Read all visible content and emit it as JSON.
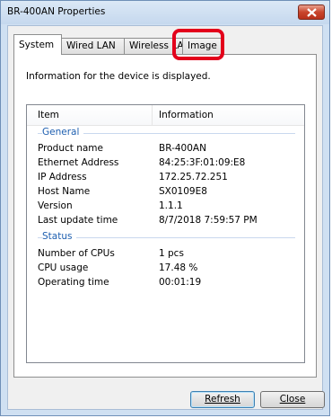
{
  "window": {
    "title": "BR-400AN Properties"
  },
  "tabs": [
    {
      "label": "System"
    },
    {
      "label": "Wired LAN"
    },
    {
      "label": "Wireless LAN"
    },
    {
      "label": "Image"
    }
  ],
  "panel": {
    "description": "Information for the device is displayed."
  },
  "list": {
    "columns": [
      "Item",
      "Information"
    ],
    "groups": [
      {
        "label": "General",
        "rows": [
          {
            "item": "Product name",
            "info": "BR-400AN"
          },
          {
            "item": "Ethernet Address",
            "info": "84:25:3F:01:09:E8"
          },
          {
            "item": "IP Address",
            "info": "172.25.72.251"
          },
          {
            "item": "Host Name",
            "info": "SX0109E8"
          },
          {
            "item": "Version",
            "info": "1.1.1"
          },
          {
            "item": "Last update time",
            "info": "8/7/2018 7:59:57 PM"
          }
        ]
      },
      {
        "label": "Status",
        "rows": [
          {
            "item": "Number of CPUs",
            "info": "1 pcs"
          },
          {
            "item": "CPU usage",
            "info": "17.48 %"
          },
          {
            "item": "Operating time",
            "info": "00:01:19"
          }
        ]
      }
    ]
  },
  "buttons": {
    "refresh": "Refresh",
    "close": "Close"
  },
  "colors": {
    "highlight": "#e3001b",
    "group_label": "#1e5fb0",
    "title_close": "#c9452c"
  },
  "icons": {
    "title_close": "close-icon"
  }
}
